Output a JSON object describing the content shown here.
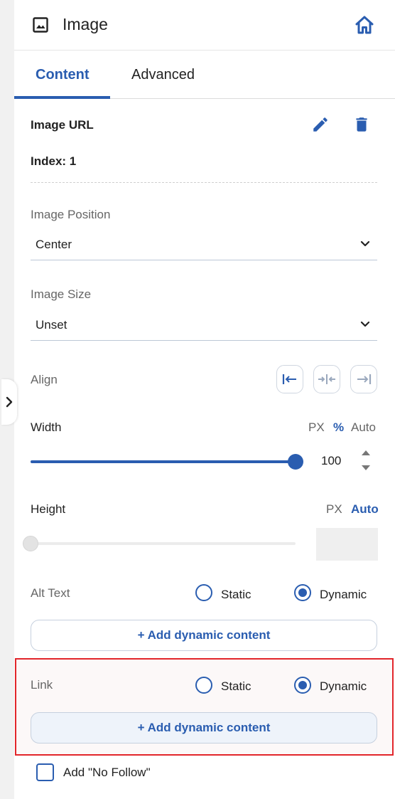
{
  "header": {
    "title": "Image",
    "title_icon": "image-icon",
    "home_icon": "home-icon"
  },
  "tabs": [
    {
      "label": "Content",
      "active": true
    },
    {
      "label": "Advanced",
      "active": false
    }
  ],
  "image_url": {
    "label": "Image URL",
    "index_text": "Index: 1",
    "edit_icon": "pencil-icon",
    "delete_icon": "trash-icon"
  },
  "image_position": {
    "label": "Image Position",
    "value": "Center"
  },
  "image_size": {
    "label": "Image Size",
    "value": "Unset"
  },
  "align": {
    "label": "Align",
    "options": [
      "align-left-icon",
      "align-center-icon",
      "align-right-icon"
    ]
  },
  "width": {
    "label": "Width",
    "units": [
      "PX",
      "%",
      "Auto"
    ],
    "active_unit": "%",
    "value": "100",
    "slider_fraction": 1.0
  },
  "height": {
    "label": "Height",
    "units": [
      "PX",
      "Auto"
    ],
    "active_unit": "Auto",
    "value": "",
    "slider_fraction": 0.0
  },
  "alt_text": {
    "label": "Alt Text",
    "options": [
      "Static",
      "Dynamic"
    ],
    "selected": "Dynamic",
    "button": "+ Add dynamic content"
  },
  "link": {
    "label": "Link",
    "options": [
      "Static",
      "Dynamic"
    ],
    "selected": "Dynamic",
    "button": "+ Add dynamic content"
  },
  "no_follow": {
    "label": "Add \"No Follow\"",
    "checked": false
  },
  "colors": {
    "accent": "#2a5db0",
    "highlight": "#e2262b"
  }
}
